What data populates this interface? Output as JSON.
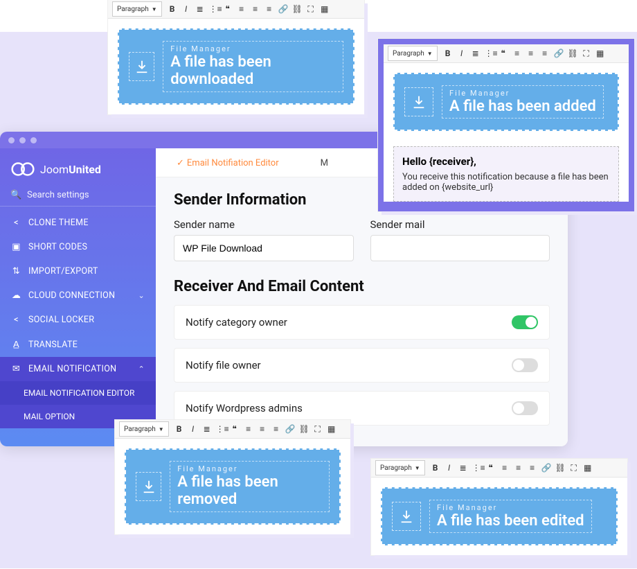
{
  "toolbar": {
    "paragraph": "Paragraph"
  },
  "notif": {
    "fm": "File Manager",
    "downloaded": "A file has been downloaded",
    "added": "A file has been added",
    "removed": "A file has been removed",
    "edited": "A file has been edited"
  },
  "email_body": {
    "greeting": "Hello {receiver},",
    "text": "You receive this notification because a file has been added on {website_url}"
  },
  "brand": {
    "part1": "Joom",
    "part2": "United"
  },
  "search": {
    "placeholder": "Search settings"
  },
  "sidebar": {
    "items": [
      {
        "label": "CLONE THEME"
      },
      {
        "label": "SHORT CODES"
      },
      {
        "label": "IMPORT/EXPORT"
      },
      {
        "label": "CLOUD CONNECTION"
      },
      {
        "label": "SOCIAL LOCKER"
      },
      {
        "label": "TRANSLATE"
      },
      {
        "label": "EMAIL NOTIFICATION"
      }
    ],
    "sub": [
      {
        "label": "EMAIL NOTIFICATION EDITOR"
      },
      {
        "label": "MAIL OPTION"
      }
    ]
  },
  "tabs": {
    "editor": "Email Notifiation Editor",
    "mail": "M"
  },
  "sender": {
    "heading": "Sender Information",
    "name_label": "Sender name",
    "name_value": "WP File Download",
    "mail_label": "Sender mail",
    "mail_value": ""
  },
  "receiver": {
    "heading": "Receiver And Email Content",
    "opt1": "Notify category owner",
    "opt2": "Notify file owner",
    "opt3": "Notify Wordpress admins"
  }
}
